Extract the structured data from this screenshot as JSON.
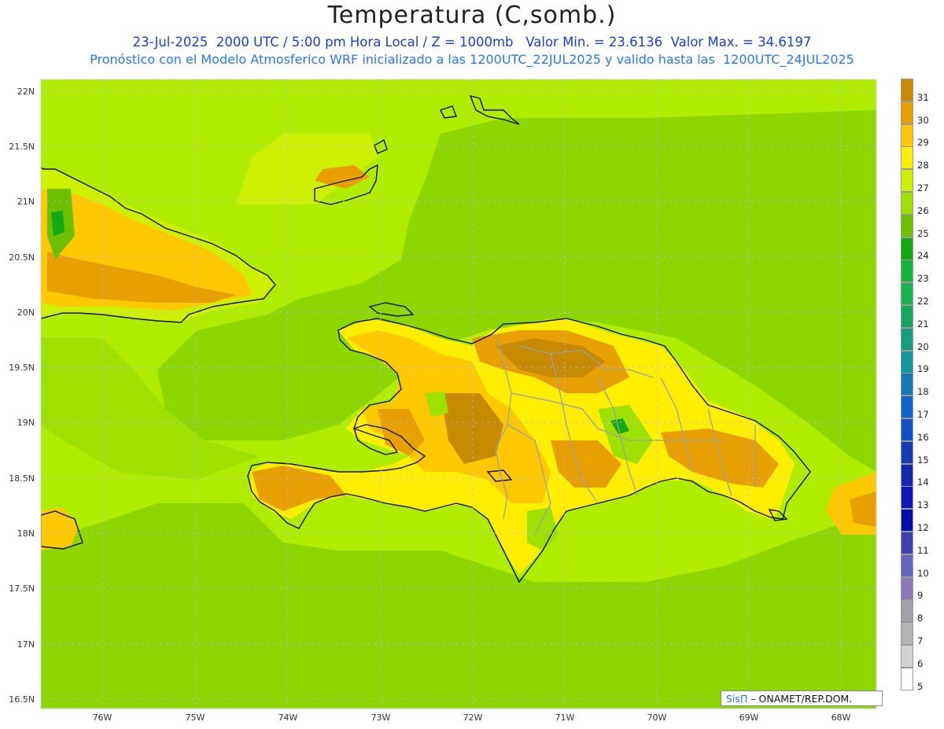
{
  "header": {
    "title": "Temperatura (C,somb.)",
    "line1": "23-Jul-2025  2000 UTC / 5:00 pm Hora Local / Z = 1000mb   Valor Min. = 23.6136  Valor Max. = 34.6197",
    "line2": "Pronóstico con el Modelo Atmosferico WRF inicializado a las 1200UTC_22JUL2025 y valido hasta las  1200UTC_24JUL2025"
  },
  "map": {
    "latitude_labels": [
      "22N",
      "21.5N",
      "21N",
      "20.5N",
      "20N",
      "19.5N",
      "19N",
      "18.5N",
      "18N",
      "17.5N",
      "17N",
      "16.5N"
    ],
    "longitude_labels": [
      "76W",
      "75W",
      "74W",
      "73W",
      "72W",
      "71W",
      "70W",
      "69W",
      "68W"
    ],
    "background_color": "#8ed600"
  },
  "legend": {
    "labels": [
      "31",
      "30",
      "29",
      "28",
      "27",
      "26",
      "25",
      "24",
      "23",
      "22",
      "21",
      "20",
      "19",
      "18",
      "17",
      "16",
      "15",
      "14",
      "13",
      "12",
      "11",
      "10",
      "9",
      "8",
      "7",
      "6",
      "5"
    ],
    "colors": [
      "#c88a00",
      "#e8a000",
      "#ffc800",
      "#ffee00",
      "#ccf000",
      "#9ee000",
      "#6cc000",
      "#14a814",
      "#14b43c",
      "#18b450",
      "#16a860",
      "#14a080",
      "#1496a0",
      "#1478b4",
      "#1464c8",
      "#1450c8",
      "#143cb4",
      "#1428b0",
      "#0c18b8",
      "#0010a8",
      "#4040b0",
      "#6464c0",
      "#8c78b8",
      "#a0a0a8",
      "#b4b4b4",
      "#d4d4d4",
      "#ffffff"
    ]
  },
  "credit": {
    "brand": "SisΠ",
    "text": "– ONAMET/REP.DOM."
  }
}
